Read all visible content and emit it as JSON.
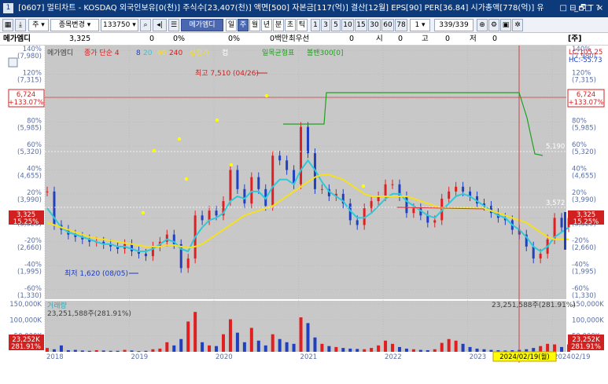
{
  "titlebar": {
    "code": "1",
    "text": "[0607] 멀티차트 - KOSDAQ 외국인보유[0(천)] 주식수[23,407(천)] 액면[500] 자본금[117(억)] 결산[12월] EPS[90] PER[36.84] 시가총액[778(억)] 유",
    "tools": "□ ⊟ 🗗 T ?",
    "min": "_",
    "max": "□",
    "close": "×"
  },
  "toolbar": {
    "type_select": "주",
    "search_select": "종목변경",
    "code_input": "133750",
    "stock_name": "메가엠디",
    "periods": [
      "일",
      "주",
      "월",
      "년",
      "분",
      "초",
      "틱"
    ],
    "active_period": "주",
    "intervals": [
      "1",
      "3",
      "5",
      "10",
      "15",
      "30",
      "60",
      "78"
    ],
    "count_select": "1",
    "page_count": "339/339"
  },
  "infobar": {
    "name": "메가엠디",
    "price": "3,325",
    "change": "0",
    "change_pct": "0%",
    "volume_pct": "0%",
    "trade_amount": "0백만",
    "best_ask_label": "최우선",
    "best_ask": "0",
    "open_label": "시",
    "open": "0",
    "high_label": "고",
    "high": "0",
    "low_label": "저",
    "low": "0",
    "unit_button": "[주]"
  },
  "chart_data": [
    {
      "type": "line",
      "title": "메가엠디",
      "legend": [
        "메가엠디",
        "종가 단순 4",
        "8",
        "20",
        "60",
        "240",
        "상한가",
        "컵",
        "일목균형표",
        "볼밴300[0]"
      ],
      "x_ticks": [
        "2018",
        "2019",
        "2020",
        "2021",
        "2022",
        "2023",
        "2024"
      ],
      "x_range": [
        "2018-01",
        "2024-03"
      ],
      "y_unit": "수익률(%) / 가격(원)",
      "y_ticks": [
        {
          "pct": "140%",
          "price": "(7,980)",
          "v": 140
        },
        {
          "pct": "120%",
          "price": "(7,315)",
          "v": 120
        },
        {
          "pct": "100%",
          "price": "(6,650)",
          "v": 100
        },
        {
          "pct": "80%",
          "price": "(5,985)",
          "v": 80
        },
        {
          "pct": "60%",
          "price": "(5,320)",
          "v": 60
        },
        {
          "pct": "40%",
          "price": "(4,655)",
          "v": 40
        },
        {
          "pct": "20%",
          "price": "(3,990)",
          "v": 20
        },
        {
          "pct": "0%",
          "price": "(3,325)",
          "v": 0
        },
        {
          "pct": "-20%",
          "price": "(2,660)",
          "v": -20
        },
        {
          "pct": "-40%",
          "price": "(1,995)",
          "v": -40
        },
        {
          "pct": "-60%",
          "price": "(1,330)",
          "v": -60
        }
      ],
      "y_range": [
        -68,
        144
      ],
      "series": [
        {
          "name": "메가엠디",
          "x": [
            "2018-01",
            "2018-02",
            "2018-03",
            "2018-04",
            "2018-05",
            "2018-06",
            "2018-07",
            "2018-08",
            "2018-09",
            "2018-10",
            "2018-11",
            "2018-12",
            "2019-01",
            "2019-02",
            "2019-03",
            "2019-04",
            "2019-05",
            "2019-06",
            "2019-07",
            "2019-08",
            "2019-09",
            "2019-10",
            "2019-11",
            "2019-12",
            "2020-01",
            "2020-02",
            "2020-03",
            "2020-04",
            "2020-05",
            "2020-06",
            "2020-07",
            "2020-08",
            "2020-09",
            "2020-10",
            "2020-11",
            "2020-12",
            "2021-01",
            "2021-02",
            "2021-03",
            "2021-04",
            "2021-05",
            "2021-06",
            "2021-07",
            "2021-08",
            "2021-09",
            "2021-10",
            "2021-11",
            "2021-12",
            "2022-01",
            "2022-02",
            "2022-03",
            "2022-04",
            "2022-05",
            "2022-06",
            "2022-07",
            "2022-08",
            "2022-09",
            "2022-10",
            "2022-11",
            "2022-12",
            "2023-01",
            "2023-02",
            "2023-03",
            "2023-04",
            "2023-05",
            "2023-06",
            "2023-07",
            "2023-08",
            "2023-09",
            "2023-10",
            "2023-11",
            "2023-12",
            "2024-01",
            "2024-02",
            "2024-03"
          ],
          "values": [
            22,
            -6,
            -10,
            -14,
            -16,
            -18,
            -20,
            -20,
            -22,
            -24,
            -26,
            -22,
            -28,
            -30,
            -32,
            -24,
            -20,
            -14,
            -22,
            -42,
            -34,
            2,
            -2,
            6,
            2,
            14,
            40,
            24,
            12,
            34,
            24,
            10,
            52,
            48,
            40,
            28,
            76,
            54,
            24,
            24,
            18,
            20,
            12,
            -2,
            -6,
            8,
            14,
            18,
            28,
            28,
            18,
            4,
            8,
            2,
            -4,
            -2,
            16,
            22,
            26,
            22,
            18,
            12,
            10,
            4,
            0,
            -2,
            -10,
            -14,
            -24,
            -34,
            -30,
            -18,
            0,
            -8,
            0
          ],
          "color": "#2040c0"
        },
        {
          "name": "20",
          "values": [
            8,
            0,
            -8,
            -12,
            -14,
            -16,
            -18,
            -20,
            -22,
            -22,
            -24,
            -24,
            -26,
            -28,
            -28,
            -26,
            -22,
            -18,
            -20,
            -26,
            -28,
            -16,
            -8,
            -2,
            0,
            4,
            14,
            18,
            16,
            22,
            22,
            16,
            26,
            32,
            32,
            28,
            40,
            48,
            40,
            30,
            22,
            18,
            14,
            6,
            0,
            0,
            4,
            10,
            16,
            20,
            20,
            14,
            10,
            6,
            2,
            0,
            6,
            12,
            18,
            20,
            18,
            14,
            10,
            6,
            2,
            0,
            -6,
            -10,
            -16,
            -24,
            -28,
            -24,
            -16,
            -12,
            -8
          ],
          "color": "#30c8d8"
        },
        {
          "name": "60",
          "values": [
            -4,
            -6,
            -8,
            -10,
            -12,
            -14,
            -16,
            -17,
            -18,
            -19,
            -20,
            -21,
            -22,
            -23,
            -24,
            -24,
            -24,
            -23,
            -23,
            -24,
            -25,
            -24,
            -22,
            -18,
            -14,
            -10,
            -6,
            -2,
            2,
            4,
            6,
            8,
            10,
            14,
            18,
            22,
            26,
            30,
            34,
            36,
            36,
            34,
            32,
            28,
            24,
            20,
            18,
            18,
            18,
            18,
            18,
            18,
            16,
            14,
            12,
            10,
            8,
            8,
            8,
            8,
            8,
            8,
            8,
            6,
            4,
            2,
            0,
            -2,
            -4,
            -8,
            -12,
            -16,
            -18,
            -18,
            -18
          ],
          "color": "#f5e020"
        }
      ],
      "annotations": {
        "high_label": "최고 7,510 (04/26)",
        "low_label": "최저 1,620 (08/05)",
        "current_left": "6,724",
        "current_left_pct": "+133.07%",
        "current_right": "6,724",
        "current_right_pct": "+133.07%",
        "price_left": "3,325",
        "price_left_pct": "15.25%",
        "price_right": "3,325",
        "price_right_pct": "15.25%",
        "level_5190": "5,190",
        "level_3572": "3,572",
        "lc": "LC:105.25",
        "hc": "HC:-55.73"
      }
    },
    {
      "type": "bar",
      "title": "거래량",
      "series_label": "23,251,588주(281.91%)",
      "right_label": "23,251,588주(281.91%)",
      "y_ticks": [
        "150,000K",
        "100,000K",
        "50,000K"
      ],
      "y_range": [
        0,
        160000
      ],
      "badge_left": "23,252K",
      "badge_left_pct": "281.91%",
      "badge_right": "23,252K",
      "badge_right_pct": "281.91%",
      "current_date": "2024/02/19(월)",
      "end_date": "02/19",
      "values": [
        12000,
        8000,
        20000,
        5000,
        6000,
        4000,
        3000,
        5000,
        4000,
        3000,
        3000,
        6000,
        4000,
        2000,
        3000,
        8000,
        10000,
        30000,
        20000,
        40000,
        95000,
        125000,
        30000,
        20000,
        18000,
        55000,
        102000,
        60000,
        30000,
        75000,
        35000,
        20000,
        55000,
        40000,
        30000,
        25000,
        108000,
        90000,
        45000,
        25000,
        18000,
        15000,
        12000,
        10000,
        9000,
        8000,
        12000,
        20000,
        35000,
        25000,
        15000,
        10000,
        8000,
        6000,
        5000,
        8000,
        28000,
        40000,
        35000,
        25000,
        15000,
        10000,
        8000,
        6000,
        5000,
        4000,
        5000,
        6000,
        8000,
        12000,
        18000,
        25000,
        23252,
        15000,
        23252
      ]
    }
  ]
}
